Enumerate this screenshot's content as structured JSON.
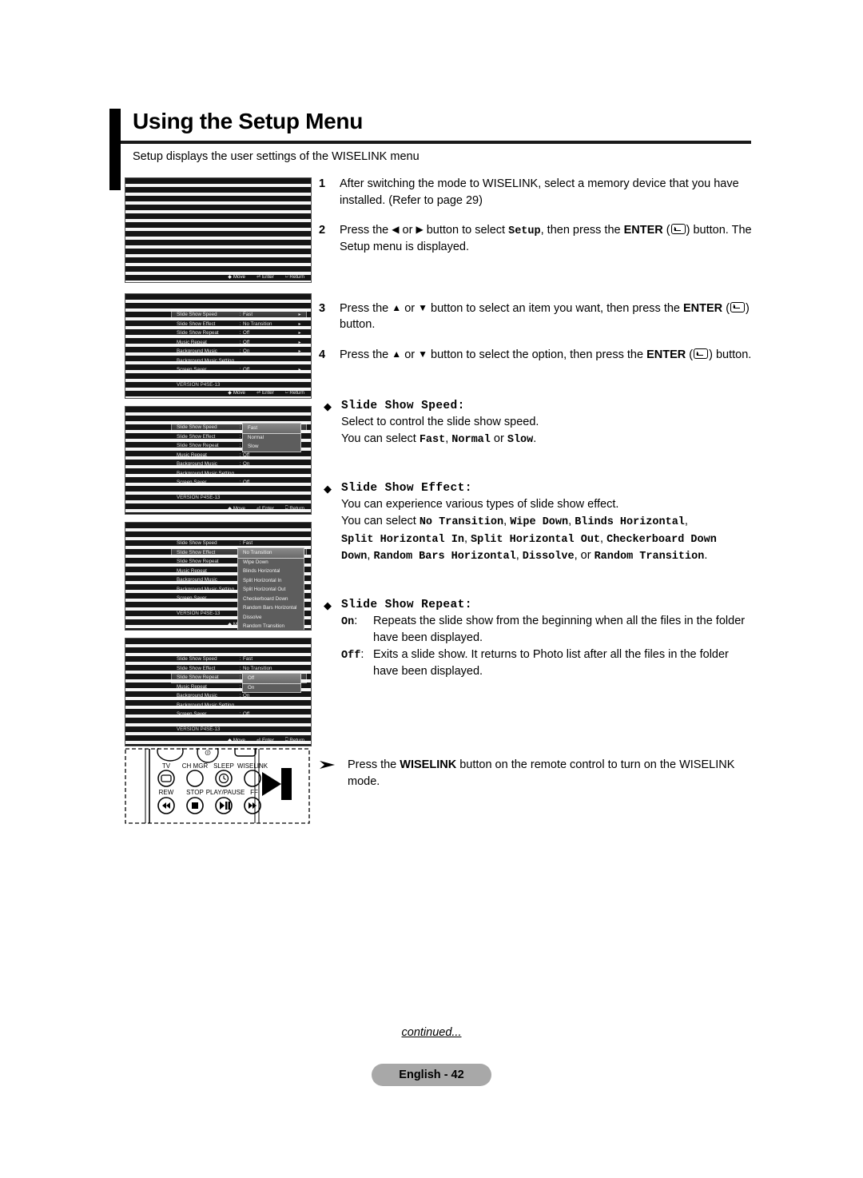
{
  "page": {
    "title": "Using the Setup Menu",
    "subtitle": "Setup displays the user settings of the WISELINK menu",
    "continued": "continued...",
    "page_badge": "English - 42"
  },
  "steps": [
    {
      "num": "1",
      "pre": "After switching the mode to WISELINK, select a memory device that you have installed. (Refer to page 29)"
    },
    {
      "num": "2",
      "a": "Press the ",
      "b": " or ",
      "c": " button to select ",
      "code": "Setup",
      "d": ", then press the ",
      "bold": "ENTER",
      "e": ") button. The Setup menu is displayed."
    },
    {
      "num": "3",
      "a": "Press the ",
      "b": " or ",
      "c": " button to select an item you want, then press the ",
      "bold": "ENTER",
      "e": ") button."
    },
    {
      "num": "4",
      "a": "Press the ",
      "b": " or ",
      "c": " button to select the option, then press the ",
      "bold": "ENTER",
      "e": ") button."
    }
  ],
  "bullets": [
    {
      "title": "Slide Show Speed:",
      "line1": "Select to control the slide show speed.",
      "line2_pre": "You can select ",
      "line2_opts": [
        "Fast",
        "Normal",
        "Slow"
      ],
      "line2_sep1": ", ",
      "line2_sep2": " or ",
      "line2_end": "."
    },
    {
      "title": "Slide Show Effect:",
      "line1": "You can experience various types of slide show effect.",
      "line2_pre": "You can select ",
      "options": [
        "No Transition",
        "Wipe Down",
        "Blinds Horizontal",
        "Split Horizontal In",
        "Split Horizontal Out",
        "Checkerboard Down",
        "Random Bars Horizontal",
        "Dissolve",
        "Random Transition"
      ],
      "or_word": "or",
      "line2_end": "."
    },
    {
      "title": "Slide Show Repeat:",
      "defs": [
        {
          "key": "On",
          "colon": ":",
          "text": "Repeats the slide show from the beginning when all the files in the folder have been displayed."
        },
        {
          "key": "Off",
          "colon": ":",
          "text": "Exits a slide show. It returns to Photo list after all the files in the folder have been displayed."
        }
      ]
    }
  ],
  "note": {
    "pre": "Press the ",
    "bold": "WISELINK",
    "post": " button on the remote control to turn on the WISELINK mode."
  },
  "menu": {
    "rows": [
      {
        "label": "Slide Show Speed",
        "value": "Fast"
      },
      {
        "label": "Slide Show Effect",
        "value": "No Transition"
      },
      {
        "label": "Slide Show Repeat",
        "value": "Off"
      },
      {
        "label": "Music Repeat",
        "value": "Off"
      },
      {
        "label": "Background Music",
        "value": "On"
      },
      {
        "label": "Background Music Setting",
        "value": ""
      },
      {
        "label": "Screen Saver",
        "value": "Off"
      }
    ],
    "version": "VERSION P4SE-13",
    "colon": ":",
    "arrow": "▸",
    "bottom": {
      "move": "Move",
      "enter": "Enter",
      "return": "Return"
    }
  },
  "dropdowns": {
    "speed": {
      "options": [
        "Fast",
        "Normal",
        "Slow"
      ],
      "selected": "Fast"
    },
    "effect": {
      "options": [
        "No Transition",
        "Wipe Down",
        "Blinds Horizontal",
        "Split Horizontal In",
        "Split Horizontal Out",
        "Checkerboard Down",
        "Random Bars Horizontal",
        "Dissolve",
        "Random Transition"
      ],
      "selected": "No Transition"
    },
    "repeat": {
      "options": [
        "Off",
        "On"
      ],
      "selected": "Off"
    }
  },
  "remote": {
    "row1": [
      "TV",
      "CH MGR",
      "SLEEP",
      "WISELINK"
    ],
    "row2": [
      "REW",
      "STOP",
      "PLAY/PAUSE",
      "FF"
    ]
  }
}
